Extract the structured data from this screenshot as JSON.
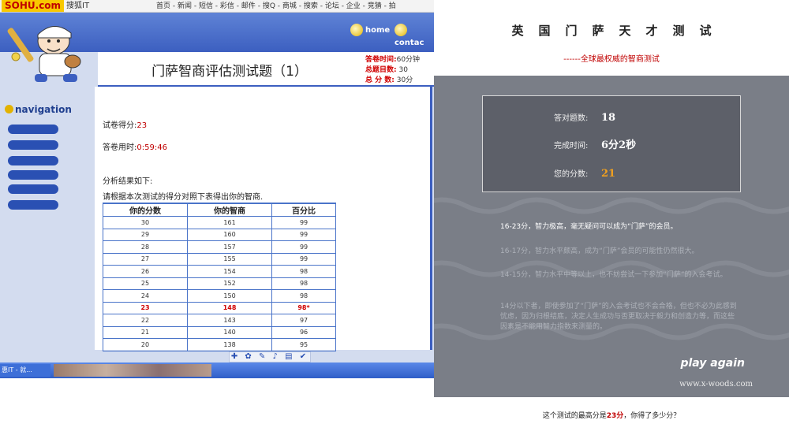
{
  "left": {
    "topbar": {
      "logo": "SOHU.com",
      "sub": "搜狐IT",
      "nav": "首页 - 新闻 - 短信 - 彩信 - 邮件 - 搜Q - 商城 - 搜索 - 论坛 - 企业 - 竞猜 - 拍"
    },
    "banner": {
      "home": "home",
      "contact": "contac"
    },
    "page_title": "门萨智商评估测试题（1）",
    "meta": [
      {
        "key": "答卷时间:",
        "value": "60分钟"
      },
      {
        "key": "总题目数:",
        "value": "30"
      },
      {
        "key": "总 分 数:",
        "value": "30分"
      }
    ],
    "nav_title": "navigation",
    "nav_item_count": 6,
    "score_line": {
      "label": "试卷得分:",
      "value": "23"
    },
    "time_line": {
      "label": "答卷用时:",
      "value": "0:59:46"
    },
    "analysis_header": "分析结果如下:",
    "instruction": "请根据本次测试的得分对照下表得出你的智商.",
    "table": {
      "headers": [
        "你的分数",
        "你的智商",
        "百分比"
      ],
      "rows": [
        [
          "30",
          "161",
          "99"
        ],
        [
          "29",
          "160",
          "99"
        ],
        [
          "28",
          "157",
          "99"
        ],
        [
          "27",
          "155",
          "99"
        ],
        [
          "26",
          "154",
          "98"
        ],
        [
          "25",
          "152",
          "98"
        ],
        [
          "24",
          "150",
          "98"
        ],
        [
          "23",
          "148",
          "98*"
        ],
        [
          "22",
          "143",
          "97"
        ],
        [
          "21",
          "140",
          "96"
        ],
        [
          "20",
          "138",
          "95"
        ]
      ],
      "highlight_index": 7
    },
    "toolbar_icons": "✚ ✿ ✎ ♪ ▤ ✔",
    "taskbar_item": "惠IT - 就..."
  },
  "right": {
    "title": "英国门萨天才测试",
    "subtitle": "------全球最权威的智商测试",
    "result": [
      {
        "key": "答对题数:",
        "value": "18"
      },
      {
        "key": "完成时间:",
        "value": "6分2秒"
      },
      {
        "key": "您的分数:",
        "value": "21"
      }
    ],
    "paragraphs": [
      "16-23分，智力极高，毫无疑问可以成为“门萨”的会员。",
      "16-17分，智力水平颇高，成为“门萨”会员的可能性仍然很大。",
      "14-15分，智力水平中等以上，也不妨尝试一下参加“门萨”的入会考试。",
      "14分以下者，即使参加了“门萨”的入会考试也不会合格，但也不必为此感到忧虑，因为归根结底，决定人生成功与否更取决于毅力和创造力等，而这些因素是不能用智力指数来测量的。"
    ],
    "play_again": "play again",
    "url": "www.x-woods.com",
    "footer": {
      "prefix": "这个测试的最高分是",
      "highest": "23分",
      "suffix": "，你得了多少分？"
    }
  },
  "colors": {
    "accent_blue": "#3c5fc0",
    "alert_red": "#c00000",
    "panel_gray": "#7a7e87",
    "score_orange": "#f0a020"
  }
}
